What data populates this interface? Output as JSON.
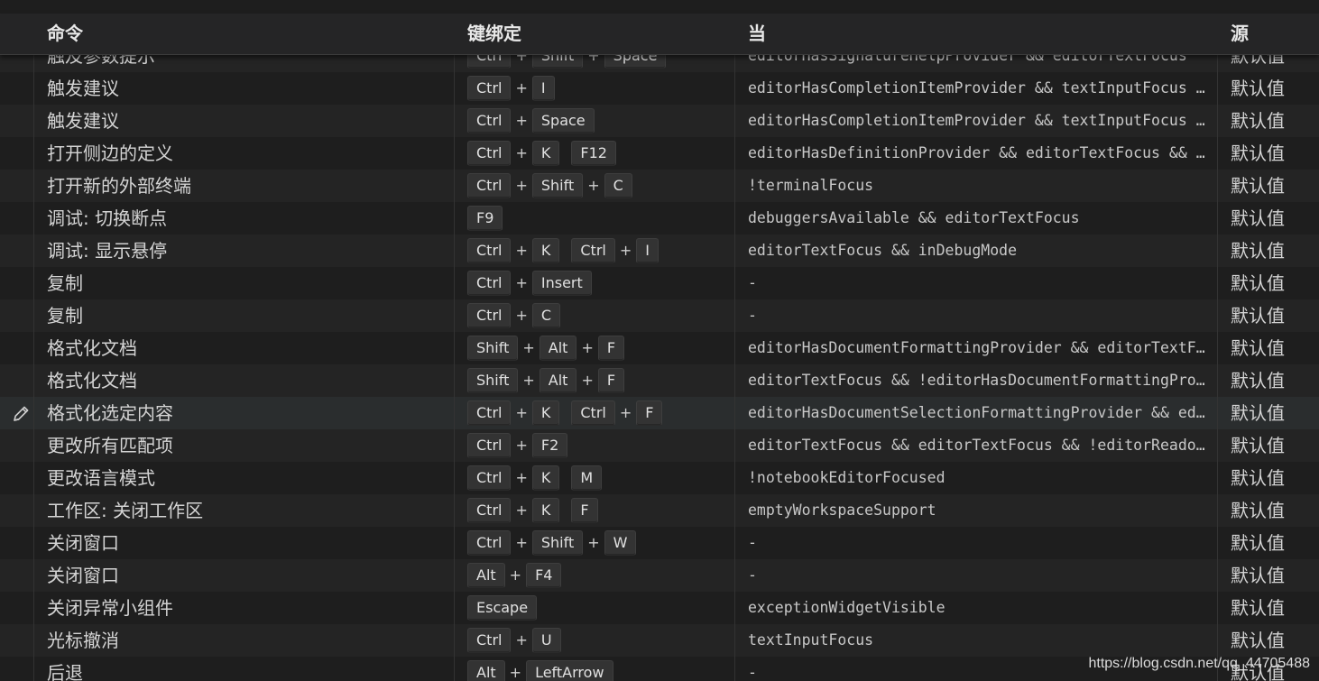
{
  "header": {
    "command": "命令",
    "keybinding": "键绑定",
    "when": "当",
    "source": "源"
  },
  "rows": [
    {
      "command": "触及参数提示",
      "chords": [
        [
          "Ctrl",
          "Shift",
          "Space"
        ]
      ],
      "when": "editorHasSignatureHelpProvider && editorTextFocus",
      "source": "默认值"
    },
    {
      "command": "触发建议",
      "chords": [
        [
          "Ctrl",
          "I"
        ]
      ],
      "when": "editorHasCompletionItemProvider && textInputFocus &&…",
      "source": "默认值"
    },
    {
      "command": "触发建议",
      "chords": [
        [
          "Ctrl",
          "Space"
        ]
      ],
      "when": "editorHasCompletionItemProvider && textInputFocus &&…",
      "source": "默认值"
    },
    {
      "command": "打开侧边的定义",
      "chords": [
        [
          "Ctrl",
          "K"
        ],
        [
          "F12"
        ]
      ],
      "when": "editorHasDefinitionProvider && editorTextFocus && !i…",
      "source": "默认值"
    },
    {
      "command": "打开新的外部终端",
      "chords": [
        [
          "Ctrl",
          "Shift",
          "C"
        ]
      ],
      "when": "!terminalFocus",
      "source": "默认值"
    },
    {
      "command": "调试: 切换断点",
      "chords": [
        [
          "F9"
        ]
      ],
      "when": "debuggersAvailable && editorTextFocus",
      "source": "默认值"
    },
    {
      "command": "调试: 显示悬停",
      "chords": [
        [
          "Ctrl",
          "K"
        ],
        [
          "Ctrl",
          "I"
        ]
      ],
      "when": "editorTextFocus && inDebugMode",
      "source": "默认值"
    },
    {
      "command": "复制",
      "chords": [
        [
          "Ctrl",
          "Insert"
        ]
      ],
      "when": " -",
      "source": "默认值"
    },
    {
      "command": "复制",
      "chords": [
        [
          "Ctrl",
          "C"
        ]
      ],
      "when": " -",
      "source": "默认值"
    },
    {
      "command": "格式化文档",
      "chords": [
        [
          "Shift",
          "Alt",
          "F"
        ]
      ],
      "when": "editorHasDocumentFormattingProvider && editorTextFoc…",
      "source": "默认值"
    },
    {
      "command": "格式化文档",
      "chords": [
        [
          "Shift",
          "Alt",
          "F"
        ]
      ],
      "when": "editorTextFocus && !editorHasDocumentFormattingProvi…",
      "source": "默认值"
    },
    {
      "command": "格式化选定内容",
      "chords": [
        [
          "Ctrl",
          "K"
        ],
        [
          "Ctrl",
          "F"
        ]
      ],
      "when": "editorHasDocumentSelectionFormattingProvider && edit…",
      "source": "默认值",
      "focused": true
    },
    {
      "command": "更改所有匹配项",
      "chords": [
        [
          "Ctrl",
          "F2"
        ]
      ],
      "when": "editorTextFocus && editorTextFocus && !editorReadonly",
      "source": "默认值"
    },
    {
      "command": "更改语言模式",
      "chords": [
        [
          "Ctrl",
          "K"
        ],
        [
          "M"
        ]
      ],
      "when": "!notebookEditorFocused",
      "source": "默认值"
    },
    {
      "command": "工作区: 关闭工作区",
      "chords": [
        [
          "Ctrl",
          "K"
        ],
        [
          "F"
        ]
      ],
      "when": "emptyWorkspaceSupport",
      "source": "默认值"
    },
    {
      "command": "关闭窗口",
      "chords": [
        [
          "Ctrl",
          "Shift",
          "W"
        ]
      ],
      "when": " -",
      "source": "默认值"
    },
    {
      "command": "关闭窗口",
      "chords": [
        [
          "Alt",
          "F4"
        ]
      ],
      "when": " -",
      "source": "默认值"
    },
    {
      "command": "关闭异常小组件",
      "chords": [
        [
          "Escape"
        ]
      ],
      "when": "exceptionWidgetVisible",
      "source": "默认值"
    },
    {
      "command": "光标撤消",
      "chords": [
        [
          "Ctrl",
          "U"
        ]
      ],
      "when": "textInputFocus",
      "source": "默认值"
    },
    {
      "command": "后退",
      "chords": [
        [
          "Alt",
          "LeftArrow"
        ]
      ],
      "when": " -",
      "source": "默认值"
    }
  ],
  "watermark": "https://blog.csdn.net/qq_44705488",
  "icons": {
    "edit": "pencil-icon"
  },
  "colors": {
    "background": "#1e1e1e",
    "header": "#252526",
    "keycap": "#333333",
    "focused_row": "#2a2d2e"
  }
}
